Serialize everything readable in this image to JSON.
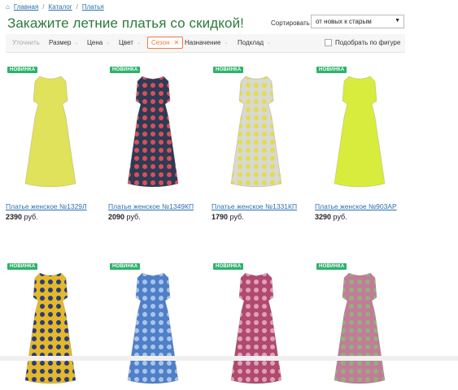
{
  "breadcrumb": {
    "items": [
      "Главная",
      "Каталог",
      "Платья"
    ],
    "separator": "/"
  },
  "page_title": "Закажите летние платья со скидкой!",
  "sort": {
    "label": "Сортировать",
    "selected": "от новых к старым"
  },
  "filters": {
    "refine": "Уточнить",
    "size": "Размер",
    "price": "Цена",
    "color": "Цвет",
    "season": "Сезон",
    "purpose": "Назначение",
    "lining": "Подклад",
    "fit_by_figure": "Подобрать по фигуре"
  },
  "badge_text": "НОВИНКА",
  "products": [
    {
      "name": "Платье женское №1329Л",
      "price": "2390",
      "currency": "руб.",
      "palette": [
        "#dfe25a",
        "#e8ea6e"
      ]
    },
    {
      "name": "Платье женское №1349КП",
      "price": "2090",
      "currency": "руб.",
      "palette": [
        "#2f3b55",
        "#d8505a"
      ]
    },
    {
      "name": "Платье женское №1331КП",
      "price": "1790",
      "currency": "руб.",
      "palette": [
        "#d9d9d0",
        "#e3dc4e"
      ]
    },
    {
      "name": "Платье женское №903АР",
      "price": "3290",
      "currency": "руб.",
      "palette": [
        "#d8ec3e",
        "#e4f25a"
      ]
    },
    {
      "name": "",
      "price": "",
      "currency": "",
      "palette": [
        "#e2b92a",
        "#2f3a7a"
      ]
    },
    {
      "name": "",
      "price": "",
      "currency": "",
      "palette": [
        "#4f7fc8",
        "#a9c6ea"
      ]
    },
    {
      "name": "",
      "price": "",
      "currency": "",
      "palette": [
        "#b04a6e",
        "#e3a0b8"
      ]
    },
    {
      "name": "",
      "price": "",
      "currency": "",
      "palette": [
        "#c47a9a",
        "#8fb27a"
      ]
    }
  ],
  "icons": {
    "home": "home-icon",
    "close": "close-icon",
    "caret": "caret-down-icon"
  }
}
